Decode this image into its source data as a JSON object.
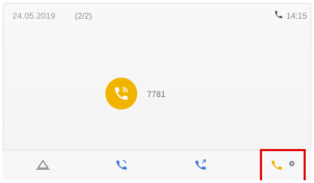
{
  "status": {
    "date": "24.05.2019",
    "page": "(2/2)",
    "time": "14:15"
  },
  "call": {
    "label": "",
    "number": "7781"
  },
  "softkeys": [
    {
      "label": "",
      "icon": "conference-icon"
    },
    {
      "label": "",
      "icon": "call-icon"
    },
    {
      "label": "",
      "icon": "transfer-icon"
    },
    {
      "label": "",
      "icon": "call-icon"
    }
  ],
  "colors": {
    "accent": "#f0b400",
    "highlight": "#e00000",
    "blue_icon": "#3c78d8"
  }
}
